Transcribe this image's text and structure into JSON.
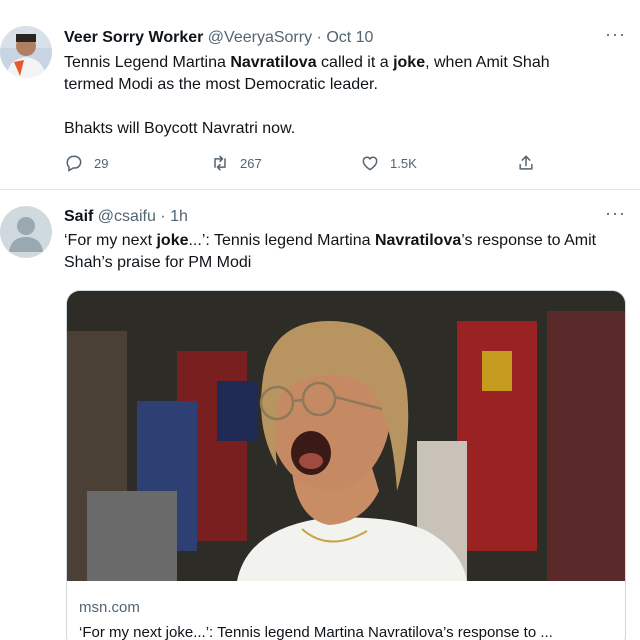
{
  "tweet1": {
    "name": "Veer Sorry Worker",
    "handle": "@VeeryaSorry",
    "sep": "·",
    "time": "Oct 10",
    "line1": {
      "a": "Tennis Legend Martina ",
      "b": "Navratilova",
      "c": " called it a ",
      "d": "joke",
      "e": ", when Amit Shah"
    },
    "line2": "termed Modi as the most Democratic leader.",
    "line3": "Bhakts will Boycott Navratri now.",
    "replies": "29",
    "retweets": "267",
    "likes": "1.5K",
    "more": "···"
  },
  "tweet2": {
    "name": "Saif",
    "handle": "@csaifu",
    "sep": "·",
    "time": "1h",
    "text": {
      "a": "‘For my next ",
      "b": "joke",
      "c": "...’: Tennis legend Martina ",
      "d": "Navratilova",
      "e": "’s response to Amit Shah’s praise for PM Modi"
    },
    "more": "···",
    "card": {
      "domain": "msn.com",
      "title": "‘For my next joke...’: Tennis legend Martina Navratilova’s response to ..."
    }
  },
  "colors": {
    "accent": "#1d9bf0",
    "secondary_text": "#536471",
    "border": "#cfd9de"
  }
}
